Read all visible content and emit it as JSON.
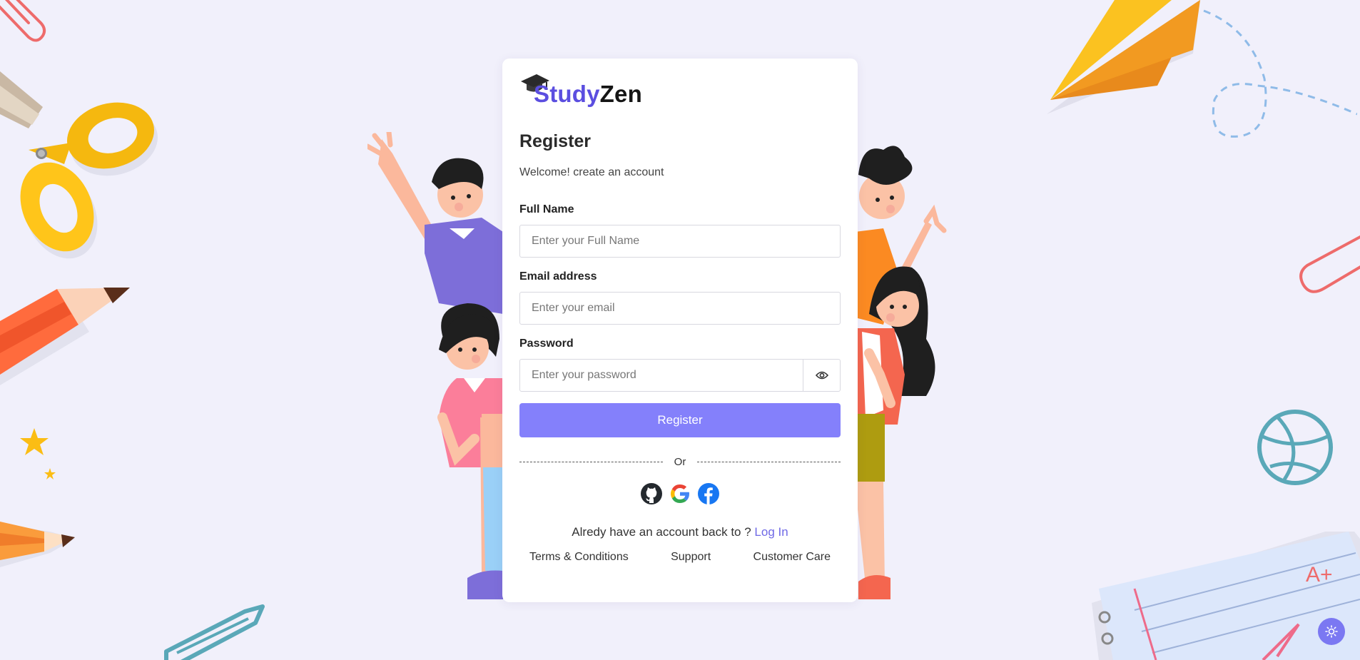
{
  "brand": {
    "part1": "Study",
    "part2": "Zen"
  },
  "form": {
    "title": "Register",
    "subtitle": "Welcome! create an account",
    "fullname_label": "Full Name",
    "fullname_placeholder": "Enter your Full Name",
    "email_label": "Email address",
    "email_placeholder": "Enter your email",
    "password_label": "Password",
    "password_placeholder": "Enter your password",
    "register_label": "Register",
    "divider_text": "Or"
  },
  "social": [
    "github-icon",
    "google-icon",
    "facebook-icon"
  ],
  "login": {
    "prompt": "Alredy have an account back to ?",
    "link": "Log In"
  },
  "footer": {
    "terms": "Terms & Conditions",
    "support": "Support",
    "care": "Customer Care"
  },
  "colors": {
    "accent": "#8480fb",
    "brand": "#5b4ee0",
    "background": "#f1f0fb",
    "link": "#6f69e6"
  }
}
